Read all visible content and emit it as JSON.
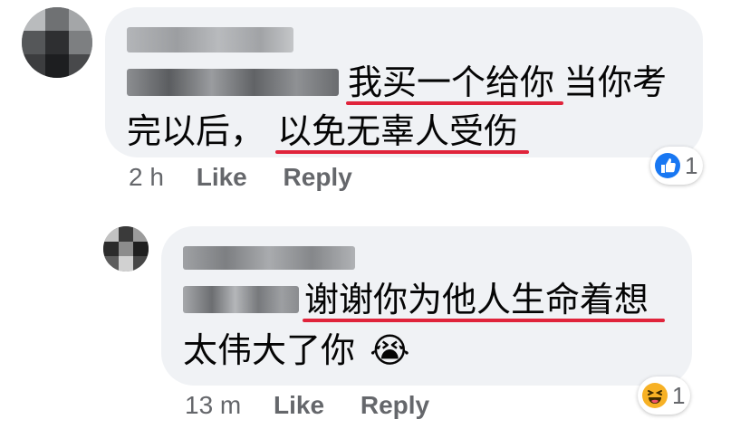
{
  "comments": [
    {
      "text_line1_highlight": "我买一个给你",
      "text_line1_rest": "当你考",
      "text_line2_pre": "完以后，",
      "text_line2_highlight": "以免无辜人受伤",
      "time": "2 h",
      "like_label": "Like",
      "reply_label": "Reply",
      "reaction": {
        "icon": "like-icon",
        "color": "#1877f2",
        "count": "1"
      }
    },
    {
      "text_line1_highlight": "谢谢你为他人生命着想",
      "text_line2": "太伟大了你",
      "text_line2_emoji": "😭",
      "time": "13 m",
      "like_label": "Like",
      "reply_label": "Reply",
      "reaction": {
        "icon": "haha-icon",
        "color": "#f7b125",
        "count": "1"
      }
    }
  ]
}
